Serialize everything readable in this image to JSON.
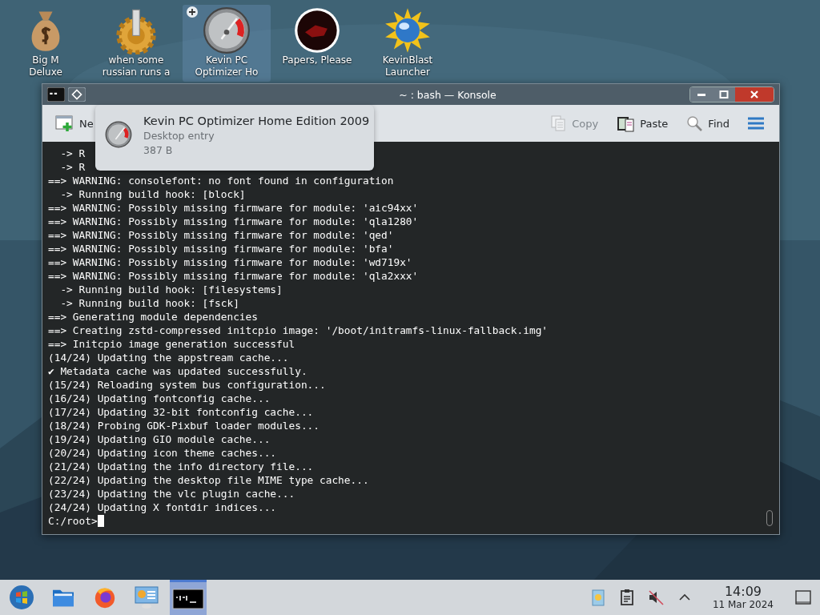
{
  "desktop_icons": [
    {
      "kind": "moneybag",
      "label_lines": [
        "Big M",
        "Deluxe"
      ],
      "selected": false
    },
    {
      "kind": "gear",
      "label_lines": [
        "when some",
        "russian runs a"
      ],
      "selected": false
    },
    {
      "kind": "gauge",
      "label_lines": [
        "Kevin PC",
        "Optimizer Ho"
      ],
      "selected": true
    },
    {
      "kind": "dark-disc",
      "label_lines": [
        "Papers, Please"
      ],
      "selected": false
    },
    {
      "kind": "sun-globe",
      "label_lines": [
        "KevinBlast",
        "Launcher"
      ],
      "selected": false
    }
  ],
  "window": {
    "title": "~ : bash — Konsole",
    "toolbar_left": [
      {
        "kind": "new-tab",
        "label": "Ne",
        "disabled": false
      }
    ],
    "toolbar_right": [
      {
        "kind": "copy",
        "label": "Copy",
        "disabled": true
      },
      {
        "kind": "paste",
        "label": "Paste",
        "disabled": false
      },
      {
        "kind": "find",
        "label": "Find",
        "disabled": false
      }
    ],
    "tooltip": {
      "title": "Kevin PC Optimizer Home Edition 2009",
      "subtitle": "Desktop entry",
      "size": "387 B"
    },
    "terminal": {
      "lines": [
        "  -> R",
        "  -> R",
        "==> WARNING: consolefont: no font found in configuration",
        "  -> Running build hook: [block]",
        "==> WARNING: Possibly missing firmware for module: 'aic94xx'",
        "==> WARNING: Possibly missing firmware for module: 'qla1280'",
        "==> WARNING: Possibly missing firmware for module: 'qed'",
        "==> WARNING: Possibly missing firmware for module: 'bfa'",
        "==> WARNING: Possibly missing firmware for module: 'wd719x'",
        "==> WARNING: Possibly missing firmware for module: 'qla2xxx'",
        "  -> Running build hook: [filesystems]",
        "  -> Running build hook: [fsck]",
        "==> Generating module dependencies",
        "==> Creating zstd-compressed initcpio image: '/boot/initramfs-linux-fallback.img'",
        "==> Initcpio image generation successful",
        "(14/24) Updating the appstream cache...",
        "✔ Metadata cache was updated successfully.",
        "(15/24) Reloading system bus configuration...",
        "(16/24) Updating fontconfig cache...",
        "(17/24) Updating 32-bit fontconfig cache...",
        "(18/24) Probing GDK-Pixbuf loader modules...",
        "(19/24) Updating GIO module cache...",
        "(20/24) Updating icon theme caches...",
        "(21/24) Updating the info directory file...",
        "(22/24) Updating the desktop file MIME type cache...",
        "(23/24) Updating the vlc plugin cache...",
        "(24/24) Updating X fontdir indices..."
      ],
      "prompt": "C:/root>"
    }
  },
  "taskbar": {
    "apps": [
      {
        "kind": "start",
        "active": false
      },
      {
        "kind": "folder",
        "active": false
      },
      {
        "kind": "firefox",
        "active": false
      },
      {
        "kind": "settings-monitor",
        "active": false
      },
      {
        "kind": "terminal",
        "active": true
      }
    ],
    "volume": {
      "muted": true
    },
    "clock": {
      "time": "14:09",
      "date": "11 Mar 2024"
    }
  }
}
